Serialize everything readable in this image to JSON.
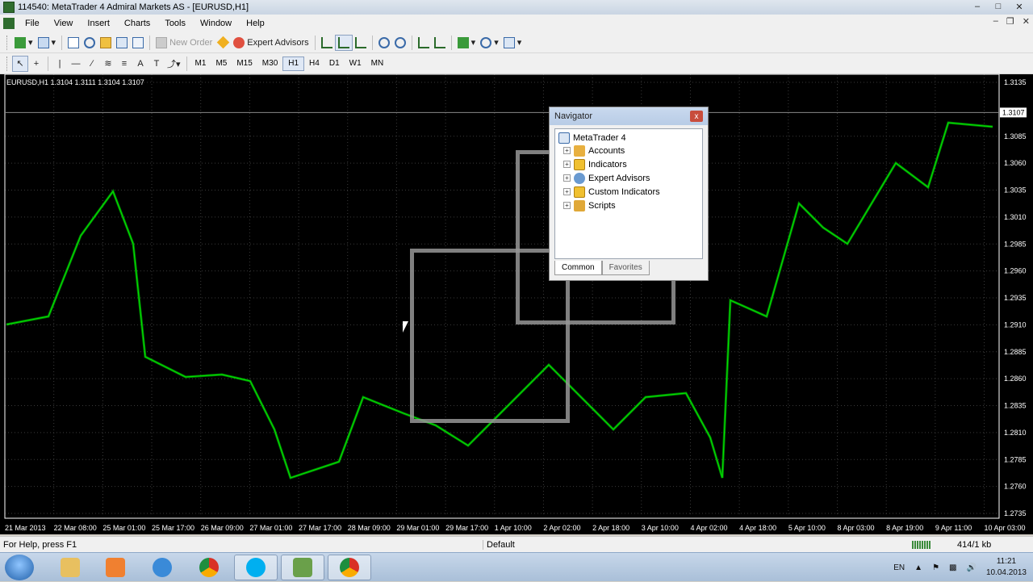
{
  "window": {
    "title": "114540: MetaTrader 4 Admiral Markets AS - [EURUSD,H1]"
  },
  "menu": [
    "File",
    "View",
    "Insert",
    "Charts",
    "Tools",
    "Window",
    "Help"
  ],
  "toolbar": {
    "new_order": "New Order",
    "expert_advisors": "Expert Advisors"
  },
  "timeframes": [
    "M1",
    "M5",
    "M15",
    "M30",
    "H1",
    "H4",
    "D1",
    "W1",
    "MN"
  ],
  "active_timeframe": "H1",
  "chart": {
    "label": "EURUSD,H1  1.3104 1.3111 1.3104 1.3107",
    "current_price": "1.3107",
    "price_labels": [
      "1.3135",
      "1.3107",
      "1.3085",
      "1.3060",
      "1.3035",
      "1.3010",
      "1.2985",
      "1.2960",
      "1.2935",
      "1.2910",
      "1.2885",
      "1.2860",
      "1.2835",
      "1.2810",
      "1.2785",
      "1.2760",
      "1.2735"
    ],
    "time_labels": [
      "21 Mar 2013",
      "22 Mar 08:00",
      "25 Mar 01:00",
      "25 Mar 17:00",
      "26 Mar 09:00",
      "27 Mar 01:00",
      "27 Mar 17:00",
      "28 Mar 09:00",
      "29 Mar 01:00",
      "29 Mar 17:00",
      "1 Apr 10:00",
      "2 Apr 02:00",
      "2 Apr 18:00",
      "3 Apr 10:00",
      "4 Apr 02:00",
      "4 Apr 18:00",
      "5 Apr 10:00",
      "8 Apr 03:00",
      "8 Apr 19:00",
      "9 Apr 11:00",
      "10 Apr 03:00"
    ],
    "colors": {
      "background": "#000000",
      "candles": "#00e000",
      "grid": "#3a3a3a"
    }
  },
  "navigator": {
    "title": "Navigator",
    "close": "x",
    "root": "MetaTrader 4",
    "items": [
      "Accounts",
      "Indicators",
      "Expert Advisors",
      "Custom Indicators",
      "Scripts"
    ],
    "tabs": [
      "Common",
      "Favorites"
    ]
  },
  "status": {
    "help": "For Help, press F1",
    "profile": "Default",
    "traffic": "414/1 kb"
  },
  "tray": {
    "lang": "EN",
    "time": "11:21",
    "date": "10.04.2013"
  }
}
